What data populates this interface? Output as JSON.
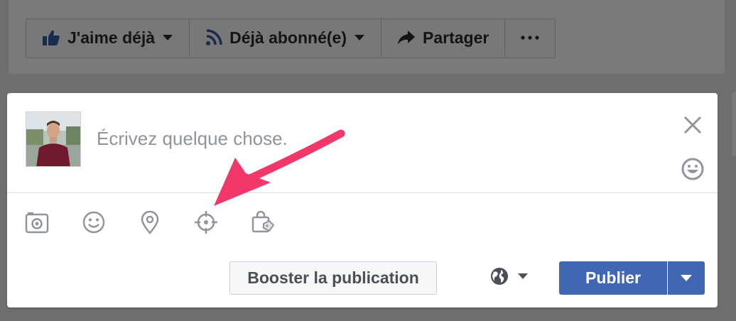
{
  "background_page": {
    "actions": [
      {
        "icon": "thumbs-up-icon",
        "label": "J'aime déjà",
        "has_dropdown": true
      },
      {
        "icon": "rss-feed-icon",
        "label": "Déjà abonné(e)",
        "has_dropdown": true
      },
      {
        "icon": "share-arrow-icon",
        "label": "Partager",
        "has_dropdown": false
      },
      {
        "icon": "more-dots-icon",
        "label": "",
        "has_dropdown": false
      }
    ]
  },
  "composer": {
    "placeholder": "Écrivez quelque chose.",
    "value": "",
    "tools": [
      "camera-icon",
      "smiley-icon",
      "location-pin-icon",
      "target-crosshair-icon",
      "shopping-bag-icon"
    ],
    "boost_label": "Booster la publication",
    "privacy_icon": "globe-icon",
    "publish_label": "Publier"
  },
  "colors": {
    "overlay_background": "#6e6e6e",
    "publish_button": "#4267b2",
    "annotation_arrow": "#f2386b",
    "placeholder_text": "#8d949e"
  }
}
